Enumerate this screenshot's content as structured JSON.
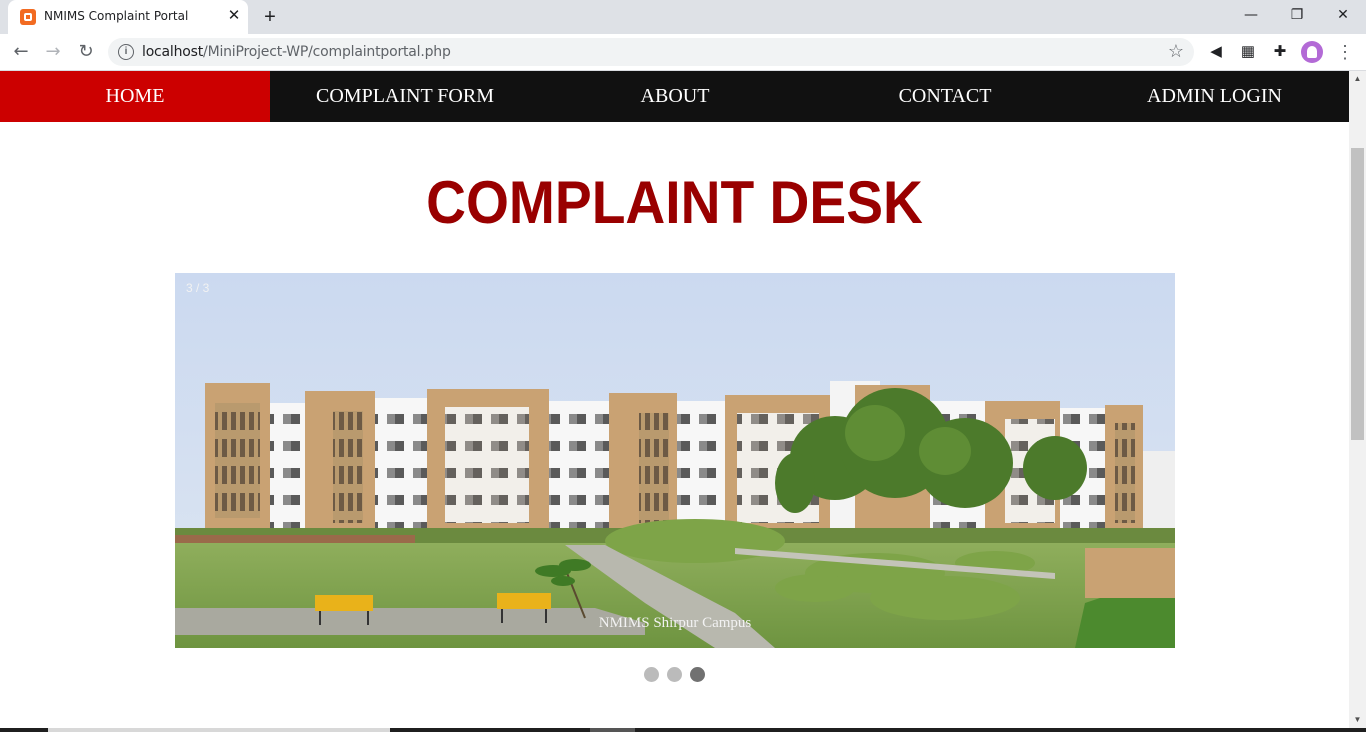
{
  "browser": {
    "tab_title": "NMIMS Complaint Portal",
    "tab_close": "✕",
    "new_tab": "+",
    "url_host": "localhost",
    "url_path": "/MiniProject-WP/complaintportal.php",
    "window_controls": {
      "minimize": "—",
      "restore": "❐",
      "close": "✕"
    },
    "nav": {
      "back": "←",
      "forward": "→",
      "reload": "↻"
    },
    "bookmark_star": "☆",
    "extensions": {
      "fish": "◀",
      "table": "▦",
      "puzzle": "✚"
    },
    "menu": "⋮"
  },
  "nav": {
    "items": [
      {
        "label": "HOME",
        "active": true
      },
      {
        "label": "COMPLAINT FORM",
        "active": false
      },
      {
        "label": "ABOUT",
        "active": false
      },
      {
        "label": "CONTACT",
        "active": false
      },
      {
        "label": "ADMIN LOGIN",
        "active": false
      }
    ]
  },
  "page": {
    "heading": "COMPLAINT DESK"
  },
  "slideshow": {
    "number_text": "3 / 3",
    "caption": "NMIMS Shirpur Campus",
    "dots": [
      false,
      false,
      true
    ]
  },
  "scrollbar": {
    "up": "▲",
    "down": "▼"
  }
}
